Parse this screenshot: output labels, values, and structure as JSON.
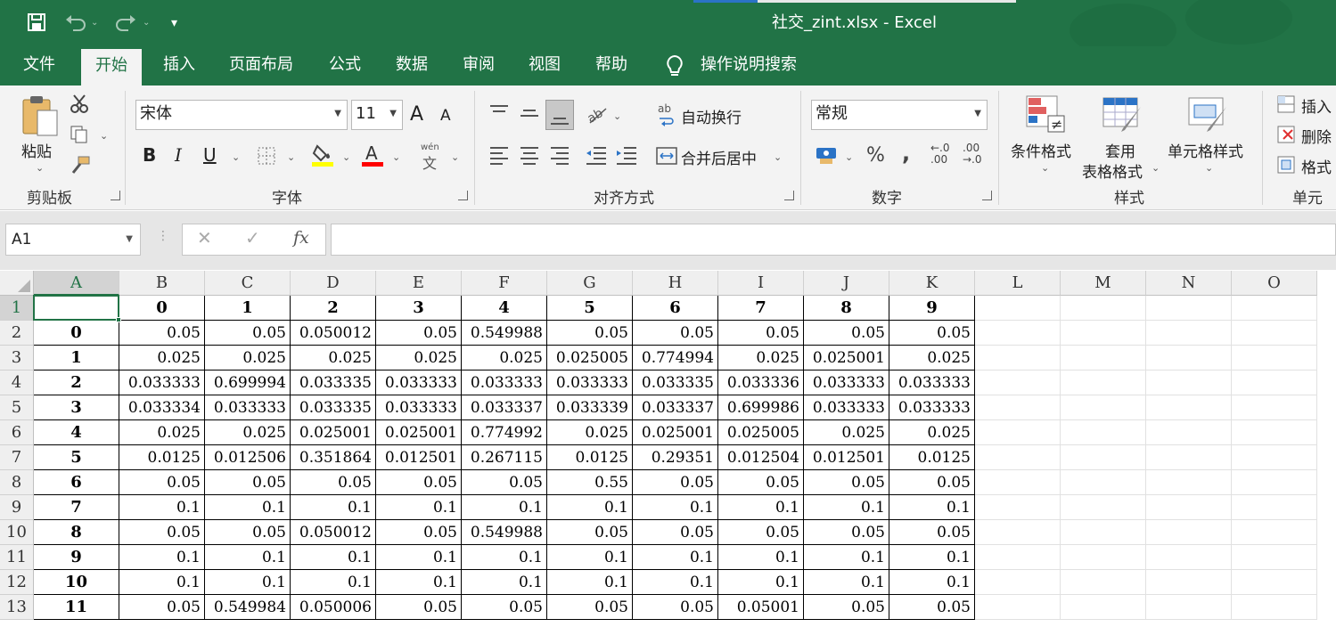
{
  "window": {
    "title": "社交_zint.xlsx  -  Excel"
  },
  "quick_access": {
    "save_icon": "save-icon",
    "undo_icon": "undo-icon",
    "redo_icon": "redo-icon",
    "customize_icon": "customize-icon"
  },
  "tabs": [
    {
      "label": "文件"
    },
    {
      "label": "开始",
      "active": true
    },
    {
      "label": "插入"
    },
    {
      "label": "页面布局"
    },
    {
      "label": "公式"
    },
    {
      "label": "数据"
    },
    {
      "label": "审阅"
    },
    {
      "label": "视图"
    },
    {
      "label": "帮助"
    },
    {
      "label": "操作说明搜索"
    }
  ],
  "ribbon": {
    "clipboard": {
      "paste": "粘贴",
      "group": "剪贴板"
    },
    "font": {
      "name": "宋体",
      "size": "11",
      "group": "字体",
      "bold": "B",
      "italic": "I",
      "underline": "U",
      "grow": "A",
      "shrink": "A",
      "phonetic_top": "wén",
      "phonetic_bottom": "文"
    },
    "alignment": {
      "wrap": "自动换行",
      "merge": "合并后居中",
      "group": "对齐方式",
      "wrap_icon": "ab"
    },
    "number": {
      "format": "常规",
      "group": "数字",
      "percent": "%",
      "comma": ",",
      "inc_decimal": "←.0\n.00",
      "dec_decimal": ".00\n→.0"
    },
    "styles": {
      "conditional": "条件格式",
      "table_line1": "套用",
      "table_line2": "表格格式",
      "cell_styles": "单元格样式",
      "group": "样式"
    },
    "cells": {
      "insert": "插入",
      "delete": "删除",
      "format": "格式",
      "group": "单元格"
    }
  },
  "formula_bar": {
    "name_box": "A1",
    "fx": "fx",
    "cancel": "✕",
    "enter": "✓"
  },
  "colors": {
    "excel_green": "#217346",
    "highlight_yellow": "#ffff00",
    "font_red": "#ff0000"
  },
  "grid": {
    "columns": [
      "A",
      "B",
      "C",
      "D",
      "E",
      "F",
      "G",
      "H",
      "I",
      "J",
      "K",
      "L",
      "M",
      "N",
      "O"
    ],
    "rows": [
      {
        "n": "1",
        "cells": [
          "",
          "0",
          "1",
          "2",
          "3",
          "4",
          "5",
          "6",
          "7",
          "8",
          "9"
        ]
      },
      {
        "n": "2",
        "cells": [
          "0",
          "0.05",
          "0.05",
          "0.050012",
          "0.05",
          "0.549988",
          "0.05",
          "0.05",
          "0.05",
          "0.05",
          "0.05"
        ]
      },
      {
        "n": "3",
        "cells": [
          "1",
          "0.025",
          "0.025",
          "0.025",
          "0.025",
          "0.025",
          "0.025005",
          "0.774994",
          "0.025",
          "0.025001",
          "0.025"
        ]
      },
      {
        "n": "4",
        "cells": [
          "2",
          "0.033333",
          "0.699994",
          "0.033335",
          "0.033333",
          "0.033333",
          "0.033333",
          "0.033335",
          "0.033336",
          "0.033333",
          "0.033333"
        ]
      },
      {
        "n": "5",
        "cells": [
          "3",
          "0.033334",
          "0.033333",
          "0.033335",
          "0.033333",
          "0.033337",
          "0.033339",
          "0.033337",
          "0.699986",
          "0.033333",
          "0.033333"
        ]
      },
      {
        "n": "6",
        "cells": [
          "4",
          "0.025",
          "0.025",
          "0.025001",
          "0.025001",
          "0.774992",
          "0.025",
          "0.025001",
          "0.025005",
          "0.025",
          "0.025"
        ]
      },
      {
        "n": "7",
        "cells": [
          "5",
          "0.0125",
          "0.012506",
          "0.351864",
          "0.012501",
          "0.267115",
          "0.0125",
          "0.29351",
          "0.012504",
          "0.012501",
          "0.0125"
        ]
      },
      {
        "n": "8",
        "cells": [
          "6",
          "0.05",
          "0.05",
          "0.05",
          "0.05",
          "0.05",
          "0.55",
          "0.05",
          "0.05",
          "0.05",
          "0.05"
        ]
      },
      {
        "n": "9",
        "cells": [
          "7",
          "0.1",
          "0.1",
          "0.1",
          "0.1",
          "0.1",
          "0.1",
          "0.1",
          "0.1",
          "0.1",
          "0.1"
        ]
      },
      {
        "n": "10",
        "cells": [
          "8",
          "0.05",
          "0.05",
          "0.050012",
          "0.05",
          "0.549988",
          "0.05",
          "0.05",
          "0.05",
          "0.05",
          "0.05"
        ]
      },
      {
        "n": "11",
        "cells": [
          "9",
          "0.1",
          "0.1",
          "0.1",
          "0.1",
          "0.1",
          "0.1",
          "0.1",
          "0.1",
          "0.1",
          "0.1"
        ]
      },
      {
        "n": "12",
        "cells": [
          "10",
          "0.1",
          "0.1",
          "0.1",
          "0.1",
          "0.1",
          "0.1",
          "0.1",
          "0.1",
          "0.1",
          "0.1"
        ]
      },
      {
        "n": "13",
        "cells": [
          "11",
          "0.05",
          "0.549984",
          "0.050006",
          "0.05",
          "0.05",
          "0.05",
          "0.05",
          "0.05001",
          "0.05",
          "0.05"
        ]
      }
    ]
  }
}
